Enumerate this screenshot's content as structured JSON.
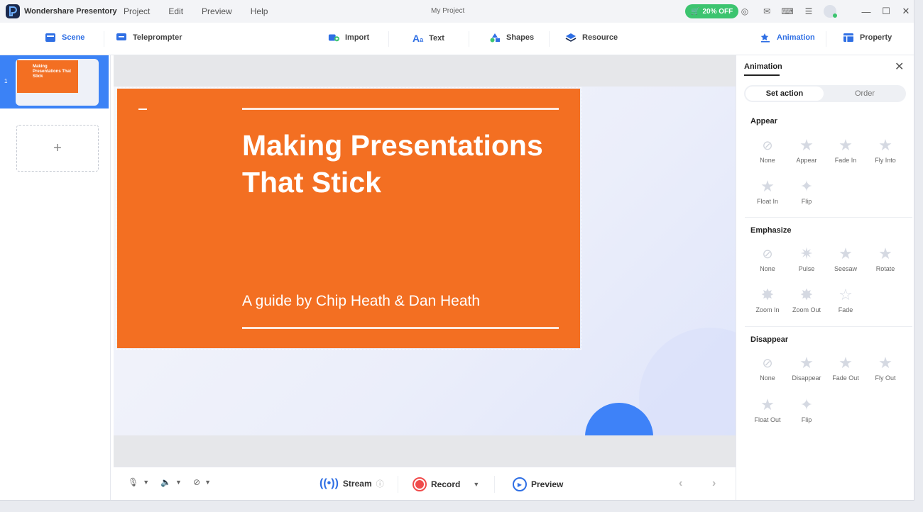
{
  "titlebar": {
    "app_name": "Wondershare Presentory",
    "menu": [
      "Project",
      "Edit",
      "Preview",
      "Help"
    ],
    "project_title": "My Project",
    "promo": "20% OFF"
  },
  "toolbar": {
    "scene": "Scene",
    "teleprompter": "Teleprompter",
    "import": "Import",
    "text": "Text",
    "shapes": "Shapes",
    "resource": "Resource",
    "animation": "Animation",
    "property": "Property"
  },
  "slides": {
    "current_number": "1",
    "thumb_title": "Making Presentations That Stick"
  },
  "slide": {
    "title": "Making Presentations That Stick",
    "subtitle": "A guide by Chip Heath & Dan Heath"
  },
  "bottom": {
    "stream": "Stream",
    "record": "Record",
    "preview": "Preview"
  },
  "panel": {
    "title": "Animation",
    "tab_set_action": "Set action",
    "tab_order": "Order",
    "appear": {
      "title": "Appear",
      "items": [
        "None",
        "Appear",
        "Fade In",
        "Fly Into",
        "Float In",
        "Flip"
      ]
    },
    "emphasize": {
      "title": "Emphasize",
      "items": [
        "None",
        "Pulse",
        "Seesaw",
        "Rotate",
        "Zoom In",
        "Zoom Out",
        "Fade"
      ]
    },
    "disappear": {
      "title": "Disappear",
      "items": [
        "None",
        "Disappear",
        "Fade Out",
        "Fly Out",
        "Float Out",
        "Flip"
      ]
    }
  },
  "colors": {
    "accent": "#2f6fe4",
    "slide_orange": "#f36f22",
    "promo_green": "#3cc46f",
    "record_red": "#f04b4b"
  }
}
